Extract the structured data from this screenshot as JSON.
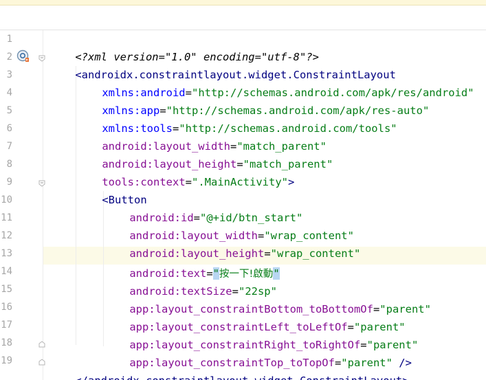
{
  "gutter": {
    "line_numbers": [
      "1",
      "2",
      "3",
      "4",
      "5",
      "6",
      "7",
      "8",
      "9",
      "10",
      "11",
      "12",
      "13",
      "14",
      "15",
      "16",
      "17",
      "18",
      "19"
    ],
    "badge_icon": "compose-preview-icon",
    "fold_icon": "fold-marker-icon"
  },
  "colors": {
    "tag": "#000080",
    "attribute": "#0000ff",
    "namespace": "#871094",
    "value": "#067d17",
    "caret_line": "#fcfae7",
    "selection": "#b8d6f2"
  },
  "code": {
    "l1": {
      "text": "<?xml version=\"1.0\" encoding=\"utf-8\"?>"
    },
    "l2": {
      "open": "<",
      "tag": "androidx.constraintlayout.widget.ConstraintLayout"
    },
    "l3": {
      "ns": "xmlns:android",
      "eq": "=",
      "value": "\"http://schemas.android.com/apk/res/android\""
    },
    "l4": {
      "ns": "xmlns:app",
      "eq": "=",
      "value": "\"http://schemas.android.com/apk/res-auto\""
    },
    "l5": {
      "ns": "xmlns:tools",
      "eq": "=",
      "value": "\"http://schemas.android.com/tools\""
    },
    "l6": {
      "ns": "android:",
      "attr": "layout_width",
      "eq": "=",
      "value": "\"match_parent\""
    },
    "l7": {
      "ns": "android:",
      "attr": "layout_height",
      "eq": "=",
      "value": "\"match_parent\""
    },
    "l8": {
      "ns": "tools:",
      "attr": "context",
      "eq": "=",
      "value": "\".MainActivity\"",
      "close": ">"
    },
    "l9": {
      "open": "<",
      "tag": "Button"
    },
    "l10": {
      "ns": "android:",
      "attr": "id",
      "eq": "=",
      "value": "\"@+id/btn_start\""
    },
    "l11": {
      "ns": "android:",
      "attr": "layout_width",
      "eq": "=",
      "value": "\"wrap_content\""
    },
    "l12": {
      "ns": "android:",
      "attr": "layout_height",
      "eq": "=",
      "value": "\"wrap_content\""
    },
    "l13": {
      "ns": "android:",
      "attr": "text",
      "eq": "=",
      "quote_open": "\"",
      "value": "按一下!啟動",
      "quote_close": "\""
    },
    "l14": {
      "ns": "android:",
      "attr": "textSize",
      "eq": "=",
      "value": "\"22sp\""
    },
    "l15": {
      "ns": "app:",
      "attr": "layout_constraintBottom_toBottomOf",
      "eq": "=",
      "value": "\"parent\""
    },
    "l16": {
      "ns": "app:",
      "attr": "layout_constraintLeft_toLeftOf",
      "eq": "=",
      "value": "\"parent\""
    },
    "l17": {
      "ns": "app:",
      "attr": "layout_constraintRight_toRightOf",
      "eq": "=",
      "value": "\"parent\""
    },
    "l18": {
      "ns": "app:",
      "attr": "layout_constraintTop_toTopOf",
      "eq": "=",
      "value": "\"parent\"",
      "close": " />"
    },
    "l19": {
      "open": "</",
      "tag": "androidx.constraintlayout.widget.ConstraintLayout",
      "close": ">"
    }
  }
}
